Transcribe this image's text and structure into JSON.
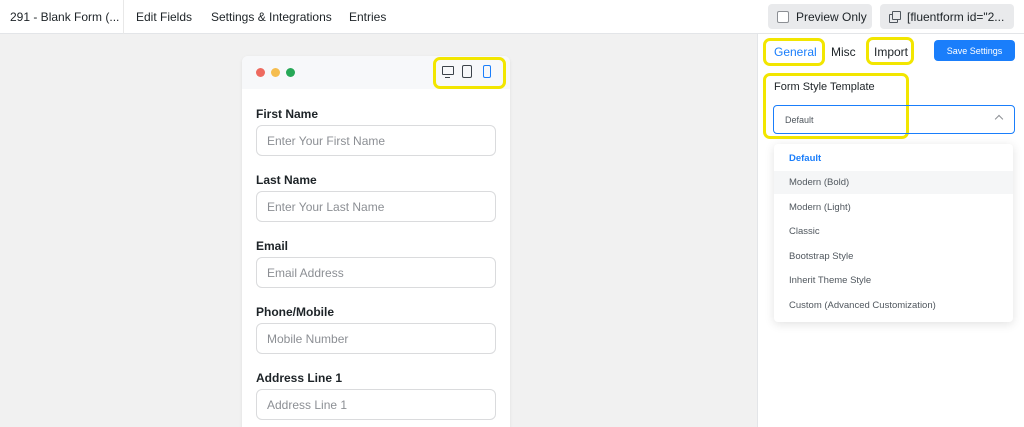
{
  "topbar": {
    "form_title": "291 - Blank Form (...",
    "nav": [
      "Edit Fields",
      "Settings & Integrations",
      "Entries"
    ],
    "preview_label": "Preview Only",
    "shortcode": "[fluentform id=\"2..."
  },
  "fields": [
    {
      "label": "First Name",
      "placeholder": "Enter Your First Name"
    },
    {
      "label": "Last Name",
      "placeholder": "Enter Your Last Name"
    },
    {
      "label": "Email",
      "placeholder": "Email Address"
    },
    {
      "label": "Phone/Mobile",
      "placeholder": "Mobile Number"
    },
    {
      "label": "Address Line 1",
      "placeholder": "Address Line 1"
    }
  ],
  "panel": {
    "tabs": [
      "General",
      "Misc",
      "Import"
    ],
    "save_label": "Save Settings",
    "section_label": "Form Style Template",
    "selected": "Default",
    "options": [
      "Default",
      "Modern (Bold)",
      "Modern (Light)",
      "Classic",
      "Bootstrap Style",
      "Inherit Theme Style",
      "Custom (Advanced Customization)"
    ]
  },
  "colors": {
    "accent": "#1a7efb",
    "highlight": "#f2e600",
    "dot_red": "#ee6a5f",
    "dot_yellow": "#f5bd4f",
    "dot_green": "#27a857"
  }
}
